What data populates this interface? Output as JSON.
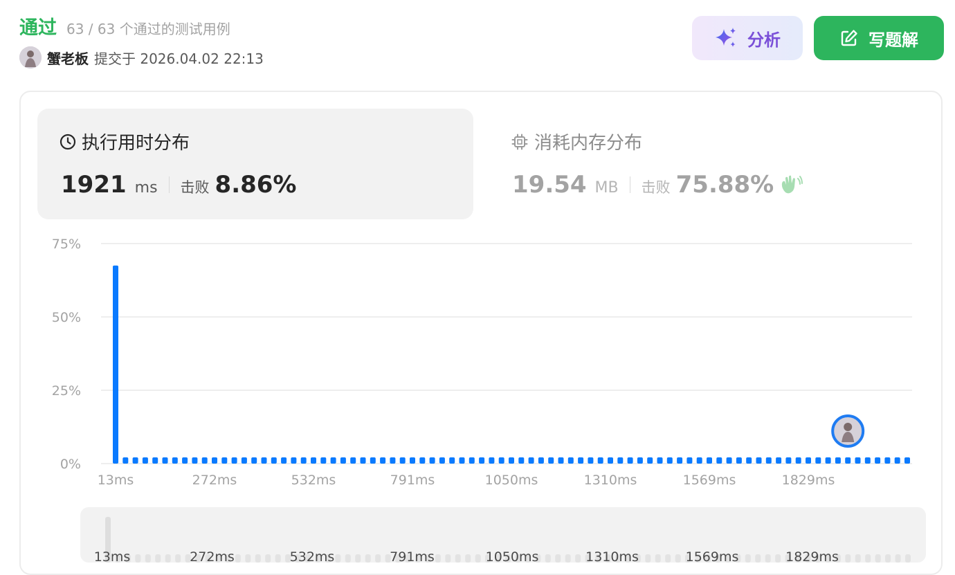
{
  "status": {
    "label": "通过",
    "cases": "63 / 63 个通过的测试用例"
  },
  "submission": {
    "user": "蟹老板",
    "meta": "提交于 2026.04.02 22:13"
  },
  "buttons": {
    "analyze": "分析",
    "solution": "写题解"
  },
  "runtime": {
    "title": "执行用时分布",
    "value": "1921",
    "unit": "ms",
    "beat_label": "击败",
    "beat": "8.86%"
  },
  "memory": {
    "title": "消耗内存分布",
    "value": "19.54",
    "unit": "MB",
    "beat_label": "击败",
    "beat": "75.88%"
  },
  "colors": {
    "accept": "#2db55d",
    "bar": "#0a7aff",
    "mini_bar": "#e3e3e3",
    "gridline": "#e8e8e8"
  },
  "icons": {
    "clock": "clock-icon",
    "chip": "chip-icon",
    "sparkle": "sparkle-icon",
    "edit": "edit-icon",
    "clap": "clap-icon"
  },
  "chart_data": {
    "type": "bar",
    "y_ticks": [
      "75%",
      "50%",
      "25%",
      "0%"
    ],
    "ylim": [
      0,
      75
    ],
    "x_tick_labels": [
      "13ms",
      "272ms",
      "532ms",
      "791ms",
      "1050ms",
      "1310ms",
      "1569ms",
      "1829ms"
    ],
    "bin_count": 81,
    "values": [
      67.5,
      0,
      0,
      0,
      0,
      0,
      0,
      0,
      0,
      0,
      0,
      0,
      0,
      0,
      0,
      0,
      0,
      0,
      0,
      0,
      0,
      0,
      0,
      0,
      0,
      0,
      0,
      0,
      0,
      0,
      0,
      0,
      0,
      0,
      0,
      0,
      0,
      0,
      0,
      0,
      0,
      0,
      0,
      0,
      0,
      0,
      0,
      0,
      0,
      0,
      0,
      0,
      0,
      0,
      0,
      0,
      0,
      0,
      0,
      0,
      0,
      0,
      0,
      0,
      0,
      0,
      0,
      0,
      0,
      0,
      0,
      0,
      0,
      0,
      0,
      0,
      0,
      0,
      0,
      0,
      0
    ],
    "user_bin_index": 74
  }
}
